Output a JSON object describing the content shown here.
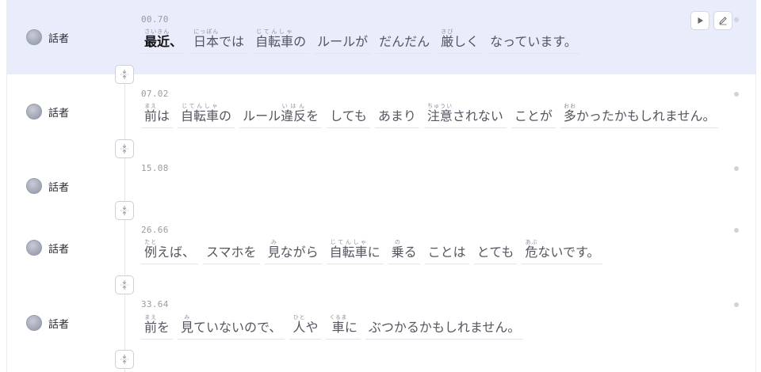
{
  "segments": [
    {
      "time": "00.70",
      "speaker": "話者",
      "active": true,
      "words": [
        [
          {
            "b": "最近",
            "r": "さいきん"
          },
          {
            "b": "、"
          }
        ],
        [
          {
            "b": "日本",
            "r": "にっぽん"
          },
          {
            "b": "では"
          }
        ],
        [
          {
            "b": "自転車",
            "r": "じてんしゃ"
          },
          {
            "b": "の"
          }
        ],
        [
          {
            "b": "ルールが"
          }
        ],
        [
          {
            "b": "だんだん"
          }
        ],
        [
          {
            "b": "厳",
            "r": "きび"
          },
          {
            "b": "しく"
          }
        ],
        [
          {
            "b": "なっています。"
          }
        ]
      ]
    },
    {
      "time": "07.02",
      "speaker": "話者",
      "words": [
        [
          {
            "b": "前",
            "r": "まえ"
          },
          {
            "b": "は"
          }
        ],
        [
          {
            "b": "自転車",
            "r": "じてんしゃ"
          },
          {
            "b": "の"
          }
        ],
        [
          {
            "b": "ルール"
          },
          {
            "b": "違反",
            "r": "いはん"
          },
          {
            "b": "を"
          }
        ],
        [
          {
            "b": "しても"
          }
        ],
        [
          {
            "b": "あまり"
          }
        ],
        [
          {
            "b": "注意",
            "r": "ちゅうい"
          },
          {
            "b": "されない"
          }
        ],
        [
          {
            "b": "ことが"
          }
        ],
        [
          {
            "b": "多",
            "r": "おお"
          },
          {
            "b": "かったかもしれません。"
          }
        ]
      ]
    },
    {
      "time": "15.08",
      "speaker": "話者",
      "words": []
    },
    {
      "time": "26.66",
      "speaker": "話者",
      "words": [
        [
          {
            "b": "例",
            "r": "たと"
          },
          {
            "b": "えば、"
          }
        ],
        [
          {
            "b": "スマホを"
          }
        ],
        [
          {
            "b": "見",
            "r": "み"
          },
          {
            "b": "ながら"
          }
        ],
        [
          {
            "b": "自転車",
            "r": "じてんしゃ"
          },
          {
            "b": "に"
          }
        ],
        [
          {
            "b": "乗",
            "r": "の"
          },
          {
            "b": "る"
          }
        ],
        [
          {
            "b": "ことは"
          }
        ],
        [
          {
            "b": "とても"
          }
        ],
        [
          {
            "b": "危",
            "r": "あぶ"
          },
          {
            "b": "ないです。"
          }
        ]
      ]
    },
    {
      "time": "33.64",
      "speaker": "話者",
      "words": [
        [
          {
            "b": "前",
            "r": "まえ"
          },
          {
            "b": "を"
          }
        ],
        [
          {
            "b": "見",
            "r": "み"
          },
          {
            "b": "ていないので、"
          }
        ],
        [
          {
            "b": "人",
            "r": "ひと"
          },
          {
            "b": "や"
          }
        ],
        [
          {
            "b": "車",
            "r": "くるま"
          },
          {
            "b": "に"
          }
        ],
        [
          {
            "b": "ぶつかるかもしれません。"
          }
        ]
      ]
    }
  ],
  "colors": {
    "active_row_bg": "#e9ecfa",
    "current_word": "#111111",
    "word_text": "#555560",
    "timestamp": "#9a9aa4"
  },
  "icons": {
    "play": "play-icon",
    "edit": "pencil-icon",
    "merge": "merge-segments-icon",
    "status": "status-dot-icon"
  }
}
